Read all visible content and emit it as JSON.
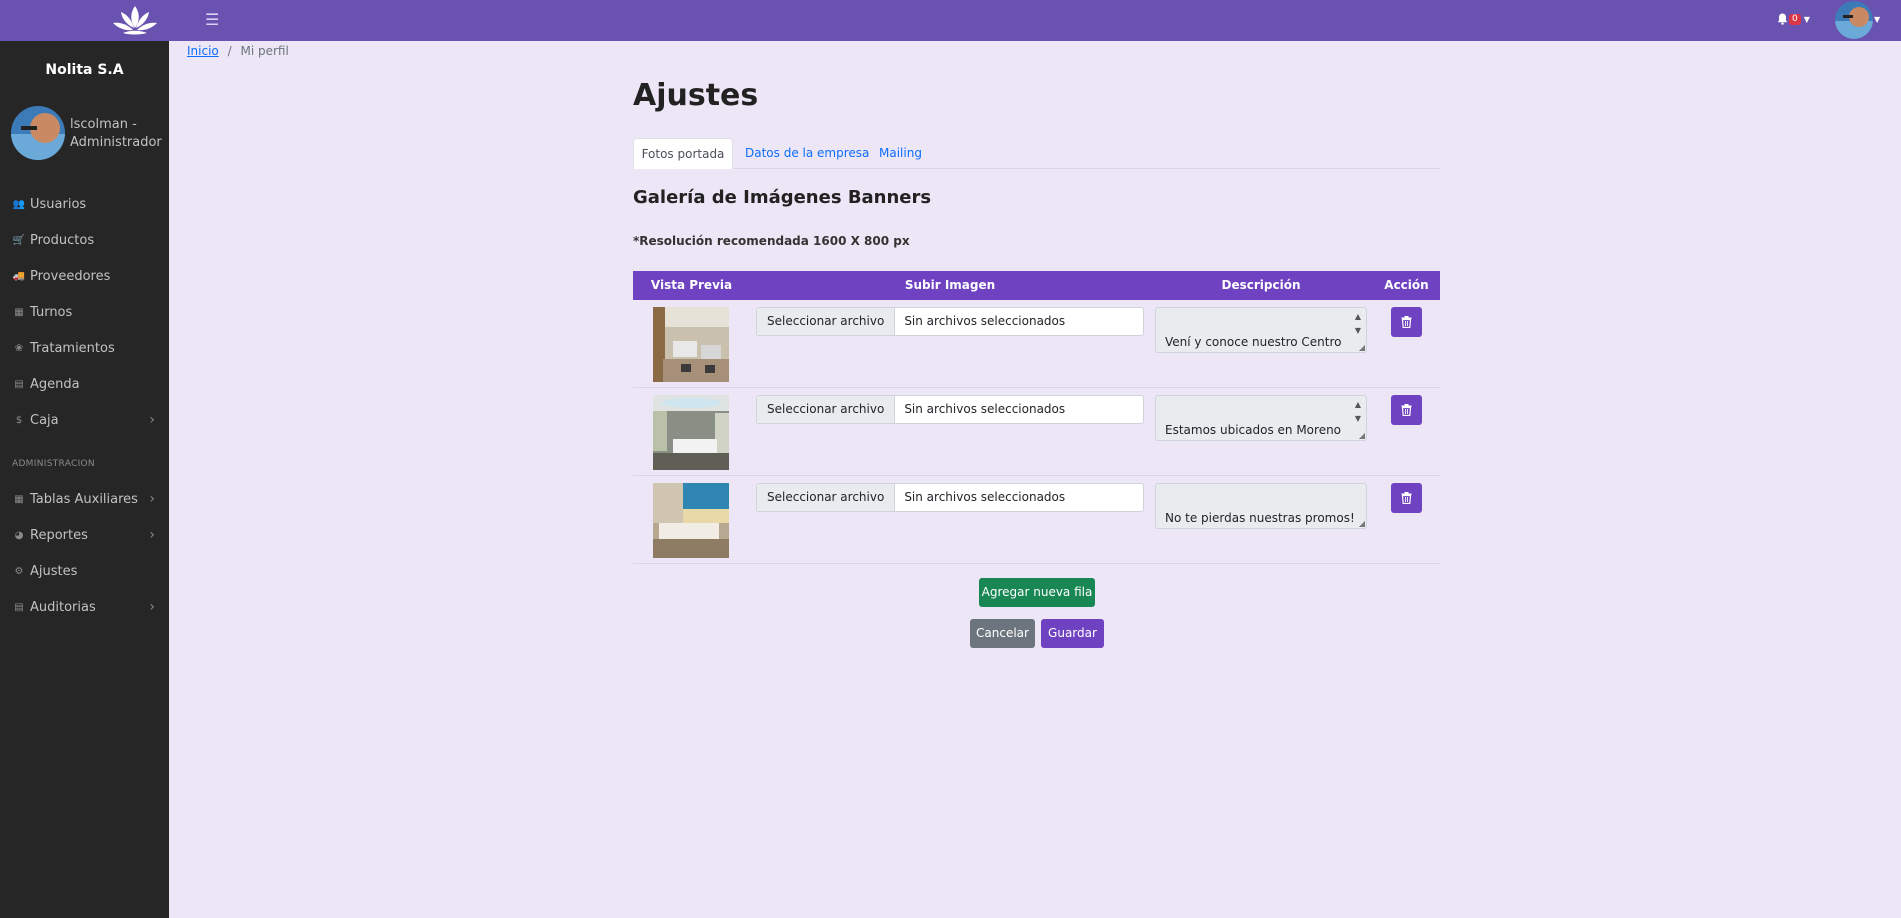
{
  "topbar": {
    "menu_icon": "hamburger-icon",
    "notifications_count": "0",
    "bell_icon": "bell-icon",
    "logo": "lotus-logo"
  },
  "sidebar": {
    "brand": "Nolita S.A",
    "user_name": "lscolman - Administrador",
    "items": [
      {
        "label": "Usuarios",
        "icon": "users-icon"
      },
      {
        "label": "Productos",
        "icon": "cart-icon"
      },
      {
        "label": "Proveedores",
        "icon": "truck-icon"
      },
      {
        "label": "Turnos",
        "icon": "calendar-icon"
      },
      {
        "label": "Tratamientos",
        "icon": "lotus-icon"
      },
      {
        "label": "Agenda",
        "icon": "book-icon"
      },
      {
        "label": "Caja",
        "icon": "dollar-icon"
      }
    ],
    "section_label": "ADMINISTRACION",
    "admin_items": [
      {
        "label": "Tablas Auxiliares",
        "icon": "table-icon"
      },
      {
        "label": "Reportes",
        "icon": "chart-pie-icon"
      },
      {
        "label": "Ajustes",
        "icon": "gear-icon"
      },
      {
        "label": "Auditorias",
        "icon": "book-icon"
      }
    ]
  },
  "breadcrumb": {
    "home": "Inicio",
    "separator": "/",
    "current": "Mi perfil"
  },
  "page": {
    "title": "Ajustes",
    "tabs": [
      "Fotos portada",
      "Datos de la empresa",
      "Mailing"
    ],
    "section_title": "Galería de Imágenes Banners",
    "hint": "*Resolución recomendada 1600 X 800 px"
  },
  "table": {
    "headers": [
      "Vista Previa",
      "Subir Imagen",
      "Descripción",
      "Acción"
    ],
    "rows": [
      {
        "file_button": "Seleccionar archivo",
        "file_status": "Sin archivos seleccionados",
        "description": "Vení y conoce nuestro Centro"
      },
      {
        "file_button": "Seleccionar archivo",
        "file_status": "Sin archivos seleccionados",
        "description": "Estamos ubicados en Moreno"
      },
      {
        "file_button": "Seleccionar archivo",
        "file_status": "Sin archivos seleccionados",
        "description": "No te pierdas nuestras promos!"
      }
    ]
  },
  "actions": {
    "add_row": "Agregar nueva fila",
    "cancel": "Cancelar",
    "save": "Guardar"
  },
  "colors": {
    "topbar": "#6952b0",
    "accent": "#6f42c1",
    "sidebar": "#262626",
    "success": "#198754",
    "secondary": "#6c757d",
    "background": "#ece6f6"
  }
}
